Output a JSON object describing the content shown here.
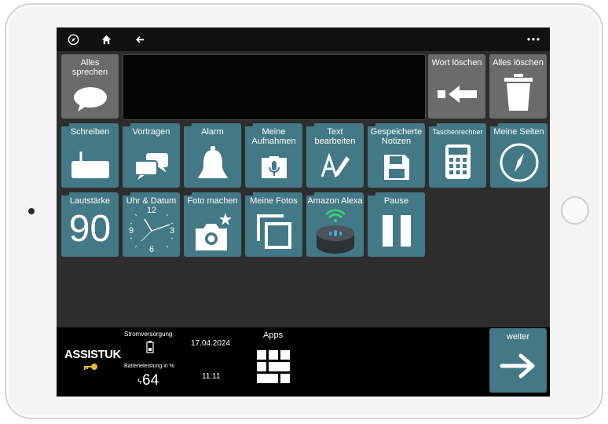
{
  "tiles_row1": {
    "alles_sprechen": "Alles sprechen",
    "wort_loeschen": "Wort löschen",
    "alles_loeschen": "Alles löschen"
  },
  "tiles_row2": [
    {
      "label": "Schreiben",
      "icon": "keyboard-icon"
    },
    {
      "label": "Vortragen",
      "icon": "chat-bubbles-icon"
    },
    {
      "label": "Alarm",
      "icon": "bell-icon"
    },
    {
      "label": "Meine Aufnahmen",
      "icon": "microphone-icon"
    },
    {
      "label": "Text bearbeiten",
      "icon": "edit-text-icon"
    },
    {
      "label": "Gespeicherte Notizen",
      "icon": "floppy-disk-icon"
    },
    {
      "label": "Taschenrechner",
      "icon": "calculator-icon"
    },
    {
      "label": "Meine Seiten",
      "icon": "compass-icon"
    }
  ],
  "tiles_row3": {
    "lautstaerke": {
      "label": "Lautstärke",
      "value": "90"
    },
    "uhr": {
      "label": "Uhr & Datum",
      "n12": "12",
      "n3": "3",
      "n6": "6",
      "n9": "9"
    },
    "foto_machen": "Foto machen",
    "meine_fotos": "Meine Fotos",
    "amazon_alexa": "Amazon Alexa",
    "pause": "Pause"
  },
  "bottom": {
    "logo": "ASSISTUK",
    "strom_label": "Stromversorgung",
    "batt_label": "Batterieleistung in %",
    "batt_value": "64",
    "date": "17.04.2024",
    "time": "11:11",
    "apps_label": "Apps",
    "weiter": "weiter"
  },
  "colors": {
    "tile": "#437886",
    "gray_tile": "#6b6b6b",
    "screen_bg": "#2d2d2d"
  }
}
